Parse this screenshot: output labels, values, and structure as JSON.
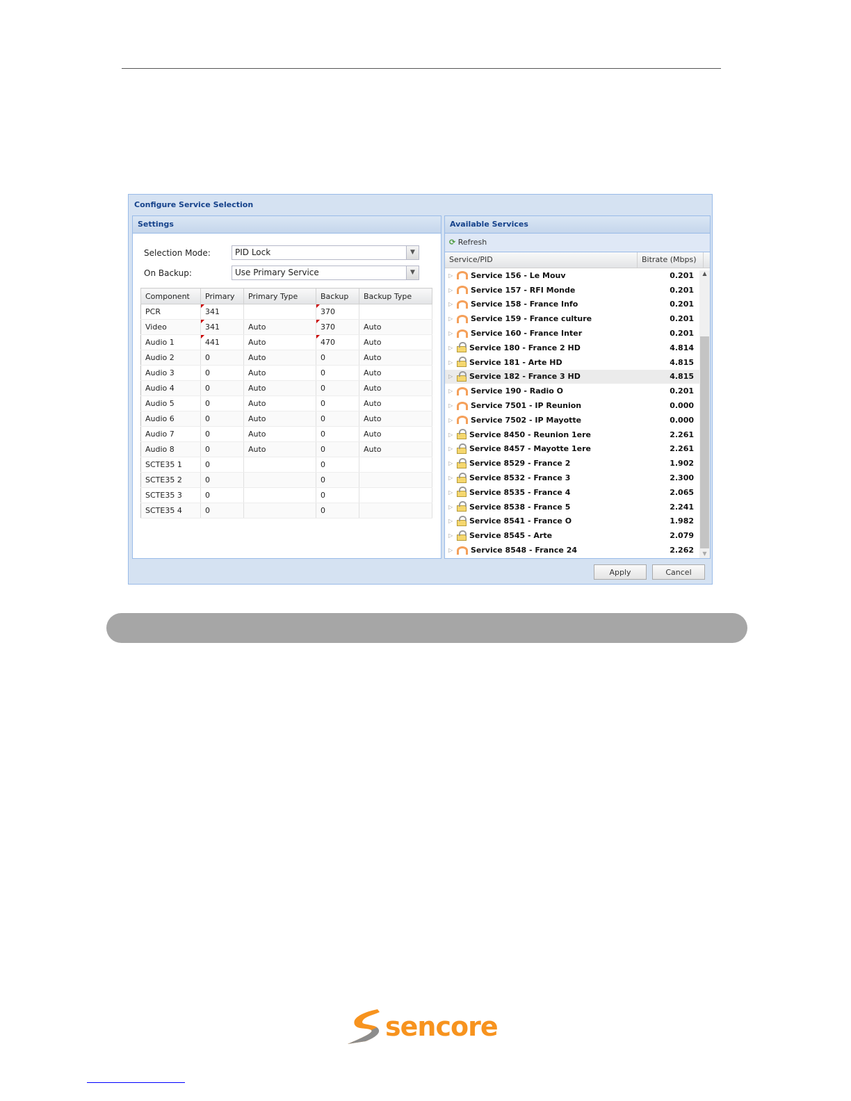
{
  "dialog": {
    "title": "Configure Service Selection",
    "settings": {
      "title": "Settings",
      "selection_mode_label": "Selection Mode:",
      "selection_mode_value": "PID Lock",
      "on_backup_label": "On Backup:",
      "on_backup_value": "Use Primary Service",
      "columns": [
        "Component",
        "Primary",
        "Primary Type",
        "Backup",
        "Backup Type"
      ],
      "rows": [
        [
          "PCR",
          "341",
          "",
          "370",
          ""
        ],
        [
          "Video",
          "341",
          "Auto",
          "370",
          "Auto"
        ],
        [
          "Audio 1",
          "441",
          "Auto",
          "470",
          "Auto"
        ],
        [
          "Audio 2",
          "0",
          "Auto",
          "0",
          "Auto"
        ],
        [
          "Audio 3",
          "0",
          "Auto",
          "0",
          "Auto"
        ],
        [
          "Audio 4",
          "0",
          "Auto",
          "0",
          "Auto"
        ],
        [
          "Audio 5",
          "0",
          "Auto",
          "0",
          "Auto"
        ],
        [
          "Audio 6",
          "0",
          "Auto",
          "0",
          "Auto"
        ],
        [
          "Audio 7",
          "0",
          "Auto",
          "0",
          "Auto"
        ],
        [
          "Audio 8",
          "0",
          "Auto",
          "0",
          "Auto"
        ],
        [
          "SCTE35 1",
          "0",
          "",
          "0",
          ""
        ],
        [
          "SCTE35 2",
          "0",
          "",
          "0",
          ""
        ],
        [
          "SCTE35 3",
          "0",
          "",
          "0",
          ""
        ],
        [
          "SCTE35 4",
          "0",
          "",
          "0",
          ""
        ]
      ]
    },
    "services": {
      "title": "Available Services",
      "refresh_label": "Refresh",
      "col_service": "Service/PID",
      "col_bitrate": "Bitrate (Mbps)",
      "items": [
        {
          "name": "Service 156 - Le Mouv",
          "bitrate": "0.201",
          "icon": "radio"
        },
        {
          "name": "Service 157 - RFI Monde",
          "bitrate": "0.201",
          "icon": "radio"
        },
        {
          "name": "Service 158 - France Info",
          "bitrate": "0.201",
          "icon": "radio"
        },
        {
          "name": "Service 159 - France culture",
          "bitrate": "0.201",
          "icon": "radio"
        },
        {
          "name": "Service 160 - France Inter",
          "bitrate": "0.201",
          "icon": "radio"
        },
        {
          "name": "Service 180 - France 2 HD",
          "bitrate": "4.814",
          "icon": "lock"
        },
        {
          "name": "Service 181 - Arte HD",
          "bitrate": "4.815",
          "icon": "lock"
        },
        {
          "name": "Service 182 - France 3 HD",
          "bitrate": "4.815",
          "icon": "lock",
          "selected": true
        },
        {
          "name": "Service 190 - Radio O",
          "bitrate": "0.201",
          "icon": "radio"
        },
        {
          "name": "Service 7501 - IP Reunion",
          "bitrate": "0.000",
          "icon": "radio"
        },
        {
          "name": "Service 7502 - IP Mayotte",
          "bitrate": "0.000",
          "icon": "radio"
        },
        {
          "name": "Service 8450 - Reunion 1ere",
          "bitrate": "2.261",
          "icon": "lock"
        },
        {
          "name": "Service 8457 - Mayotte 1ere",
          "bitrate": "2.261",
          "icon": "lock"
        },
        {
          "name": "Service 8529 - France 2",
          "bitrate": "1.902",
          "icon": "lock"
        },
        {
          "name": "Service 8532 - France 3",
          "bitrate": "2.300",
          "icon": "lock"
        },
        {
          "name": "Service 8535 - France 4",
          "bitrate": "2.065",
          "icon": "lock"
        },
        {
          "name": "Service 8538 - France 5",
          "bitrate": "2.241",
          "icon": "lock"
        },
        {
          "name": "Service 8541 - France O",
          "bitrate": "1.982",
          "icon": "lock"
        },
        {
          "name": "Service 8545 - Arte",
          "bitrate": "2.079",
          "icon": "lock"
        },
        {
          "name": "Service 8548 - France 24",
          "bitrate": "2.262",
          "icon": "radio"
        }
      ]
    },
    "apply_label": "Apply",
    "cancel_label": "Cancel"
  },
  "logo_text": "sencore",
  "colors": {
    "logo_orange": "#f7931e",
    "logo_gray": "#8c8c8c"
  }
}
